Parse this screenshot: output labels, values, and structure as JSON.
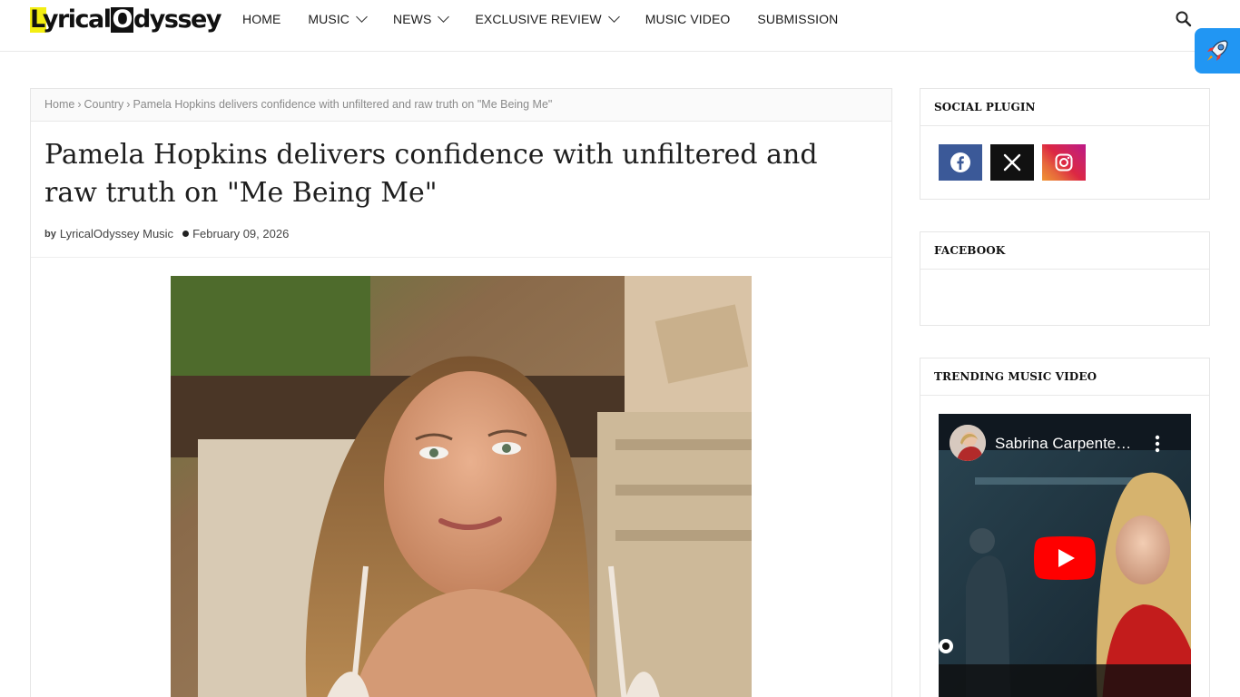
{
  "header": {
    "logo_text_pre": "Lyrical",
    "logo_text_o": "O",
    "logo_text_post": "dyssey",
    "nav": [
      {
        "label": "HOME",
        "dropdown": false
      },
      {
        "label": "MUSIC",
        "dropdown": true
      },
      {
        "label": "NEWS",
        "dropdown": true
      },
      {
        "label": "EXCLUSIVE REVIEW",
        "dropdown": true
      },
      {
        "label": "MUSIC VIDEO",
        "dropdown": false
      },
      {
        "label": "SUBMISSION",
        "dropdown": false
      }
    ],
    "search_icon": "search-icon",
    "rocket_icon": "rocket-icon"
  },
  "breadcrumb": {
    "home": "Home",
    "category": "Country",
    "current": "Pamela Hopkins delivers confidence with unfiltered and raw truth on \"Me Being Me\""
  },
  "post": {
    "title": "Pamela Hopkins delivers confidence with unfiltered and raw truth on \"Me Being Me\"",
    "by_label": "by",
    "author": "LyricalOdyssey Music",
    "date": "February 09, 2026"
  },
  "sidebar": {
    "social_title": "SOCIAL PLUGIN",
    "social": [
      {
        "name": "facebook",
        "icon": "facebook-icon",
        "color": "#3b5998"
      },
      {
        "name": "x",
        "icon": "x-icon",
        "color": "#111111"
      },
      {
        "name": "instagram",
        "icon": "instagram-icon",
        "color": "#dc2743"
      }
    ],
    "facebook_title": "FACEBOOK",
    "trending_title": "TRENDING MUSIC VIDEO",
    "video": {
      "title": "Sabrina Carpente…"
    }
  },
  "colors": {
    "accent": "#2196f3",
    "logo_yellow": "#f3ee12",
    "youtube_red": "#ff0000"
  }
}
